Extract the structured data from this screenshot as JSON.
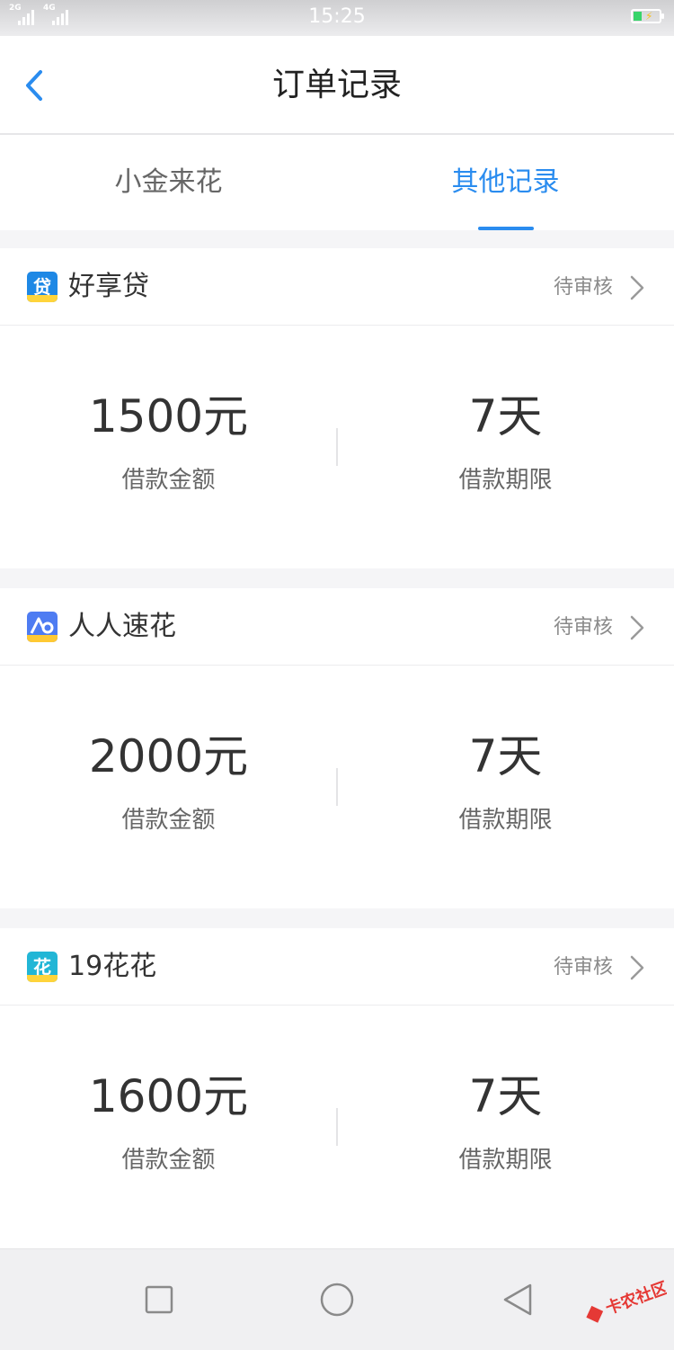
{
  "status_bar": {
    "left_labels": [
      "2G",
      "4G"
    ],
    "time": "15:25"
  },
  "header": {
    "title": "订单记录"
  },
  "tabs": [
    {
      "label": "小金来花",
      "active": false
    },
    {
      "label": "其他记录",
      "active": true
    }
  ],
  "orders": [
    {
      "name": "好享贷",
      "icon": "loan-logo-icon",
      "status": "待审核",
      "amount": "1500元",
      "amount_label": "借款金额",
      "term": "7天",
      "term_label": "借款期限"
    },
    {
      "name": "人人速花",
      "icon": "renren-logo-icon",
      "status": "待审核",
      "amount": "2000元",
      "amount_label": "借款金额",
      "term": "7天",
      "term_label": "借款期限"
    },
    {
      "name": "19花花",
      "icon": "huahua-logo-icon",
      "status": "待审核",
      "amount": "1600元",
      "amount_label": "借款金额",
      "term": "7天",
      "term_label": "借款期限"
    }
  ],
  "watermark": {
    "text": "卡农社区"
  },
  "colors": {
    "accent": "#2a8cef",
    "background": "#f5f5f7"
  }
}
